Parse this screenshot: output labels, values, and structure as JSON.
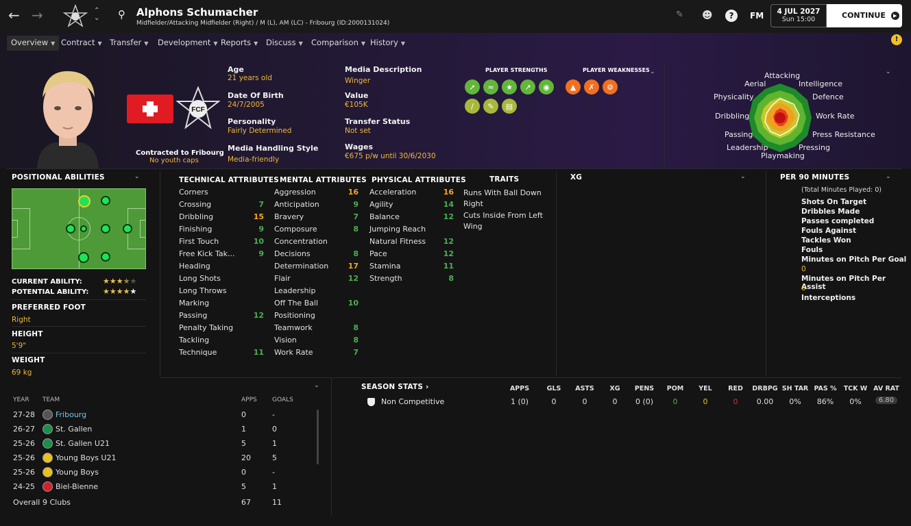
{
  "header": {
    "player_name": "Alphons Schumacher",
    "subtitle": "Midfielder/Attacking Midfielder (Right) / M (L), AM (LC) - Fribourg (ID:2000131024)",
    "date": "4 JUL 2027",
    "time": "Sun 15:00",
    "continue_label": "CONTINUE",
    "fm_label": "FM"
  },
  "tabs": [
    "Overview",
    "Contract",
    "Transfer",
    "Development",
    "Reports",
    "Discuss",
    "Comparison",
    "History"
  ],
  "profile": {
    "contracted_label": "Contracted to Fribourg",
    "caps": "No youth caps",
    "club_crest_text": "FCF"
  },
  "info": {
    "age_label": "Age",
    "age": "21 years old",
    "dob_label": "Date Of Birth",
    "dob": "24/7/2005",
    "personality_label": "Personality",
    "personality": "Fairly Determined",
    "media_style_label": "Media Handling Style",
    "media_style": "Media-friendly",
    "media_desc_label": "Media Description",
    "media_desc": "Winger",
    "value_label": "Value",
    "value": "€105K",
    "transfer_status_label": "Transfer Status",
    "transfer_status": "Not set",
    "wages_label": "Wages",
    "wages": "€675 p/w until 30/6/2030"
  },
  "strengths_label": "PLAYER STRENGTHS",
  "weaknesses_label": "PLAYER WEAKNESSES",
  "radar": {
    "labels": [
      "Attacking",
      "Intelligence",
      "Defence",
      "Work Rate",
      "Press Resistance",
      "Pressing",
      "Playmaking",
      "Leadership",
      "Passing",
      "Dribbling",
      "Physicality",
      "Aerial"
    ]
  },
  "positional": {
    "title": "POSITIONAL ABILITIES",
    "current_ability_label": "CURRENT ABILITY:",
    "current_ability_stars": 3.5,
    "potential_ability_label": "POTENTIAL ABILITY:",
    "potential_ability_stars": 4.5,
    "preferred_foot_label": "PREFERRED FOOT",
    "preferred_foot": "Right",
    "height_label": "HEIGHT",
    "height": "5'9\"",
    "weight_label": "WEIGHT",
    "weight": "69 kg"
  },
  "technical": {
    "title": "TECHNICAL ATTRIBUTES",
    "rows": [
      [
        "Corners",
        ""
      ],
      [
        "Crossing",
        "7"
      ],
      [
        "Dribbling",
        "15"
      ],
      [
        "Finishing",
        "9"
      ],
      [
        "First Touch",
        "10"
      ],
      [
        "Free Kick Tak...",
        "9"
      ],
      [
        "Heading",
        ""
      ],
      [
        "Long Shots",
        ""
      ],
      [
        "Long Throws",
        ""
      ],
      [
        "Marking",
        ""
      ],
      [
        "Passing",
        "12"
      ],
      [
        "Penalty Taking",
        ""
      ],
      [
        "Tackling",
        ""
      ],
      [
        "Technique",
        "11"
      ]
    ]
  },
  "mental": {
    "title": "MENTAL ATTRIBUTES",
    "rows": [
      [
        "Aggression",
        "16"
      ],
      [
        "Anticipation",
        "9"
      ],
      [
        "Bravery",
        "7"
      ],
      [
        "Composure",
        "8"
      ],
      [
        "Concentration",
        ""
      ],
      [
        "Decisions",
        "8"
      ],
      [
        "Determination",
        "17"
      ],
      [
        "Flair",
        "12"
      ],
      [
        "Leadership",
        ""
      ],
      [
        "Off The Ball",
        "10"
      ],
      [
        "Positioning",
        ""
      ],
      [
        "Teamwork",
        "8"
      ],
      [
        "Vision",
        "8"
      ],
      [
        "Work Rate",
        "7"
      ]
    ]
  },
  "physical": {
    "title": "PHYSICAL ATTRIBUTES",
    "rows": [
      [
        "Acceleration",
        "16"
      ],
      [
        "Agility",
        "14"
      ],
      [
        "Balance",
        "12"
      ],
      [
        "Jumping Reach",
        ""
      ],
      [
        "Natural Fitness",
        "12"
      ],
      [
        "Pace",
        "12"
      ],
      [
        "Stamina",
        "11"
      ],
      [
        "Strength",
        "8"
      ]
    ]
  },
  "traits": {
    "title": "TRAITS",
    "items": [
      "Runs With Ball Down Right",
      "Cuts Inside From Left Wing"
    ]
  },
  "xg": {
    "title": "XG"
  },
  "per90": {
    "title": "PER 90 MINUTES",
    "total": "(Total Minutes Played: 0)",
    "items": [
      "Shots On Target",
      "Dribbles Made",
      "Passes completed",
      "Fouls Against",
      "Tackles Won",
      "Fouls"
    ],
    "mins_goal_label": "Minutes on Pitch Per Goal",
    "mins_goal": "0",
    "mins_assist_label": "Minutes on Pitch Per Assist",
    "mins_assist": "0",
    "interceptions": "Interceptions"
  },
  "history": {
    "headers": [
      "YEAR",
      "TEAM",
      "APPS",
      "GOALS"
    ],
    "rows": [
      [
        "27-28",
        "Fribourg",
        "0",
        "-"
      ],
      [
        "26-27",
        "St. Gallen",
        "1",
        "0"
      ],
      [
        "25-26",
        "St. Gallen U21",
        "5",
        "1"
      ],
      [
        "25-26",
        "Young Boys U21",
        "20",
        "5"
      ],
      [
        "25-26",
        "Young Boys",
        "0",
        "-"
      ],
      [
        "24-25",
        "Biel-Bienne",
        "5",
        "1"
      ]
    ],
    "overall": [
      "Overall",
      "9 Clubs",
      "67",
      "11"
    ]
  },
  "season": {
    "title": "SEASON STATS",
    "headers": [
      "APPS",
      "GLS",
      "ASTS",
      "XG",
      "PENS",
      "POM",
      "YEL",
      "RED",
      "DRBPG",
      "SH TAR",
      "PAS %",
      "TCK W",
      "AV RAT"
    ],
    "row_label": "Non Competitive",
    "values": [
      "1 (0)",
      "0",
      "0",
      "0",
      "0 (0)",
      "0",
      "0",
      "0",
      "0.00",
      "0%",
      "86%",
      "0%",
      "6.80"
    ]
  }
}
